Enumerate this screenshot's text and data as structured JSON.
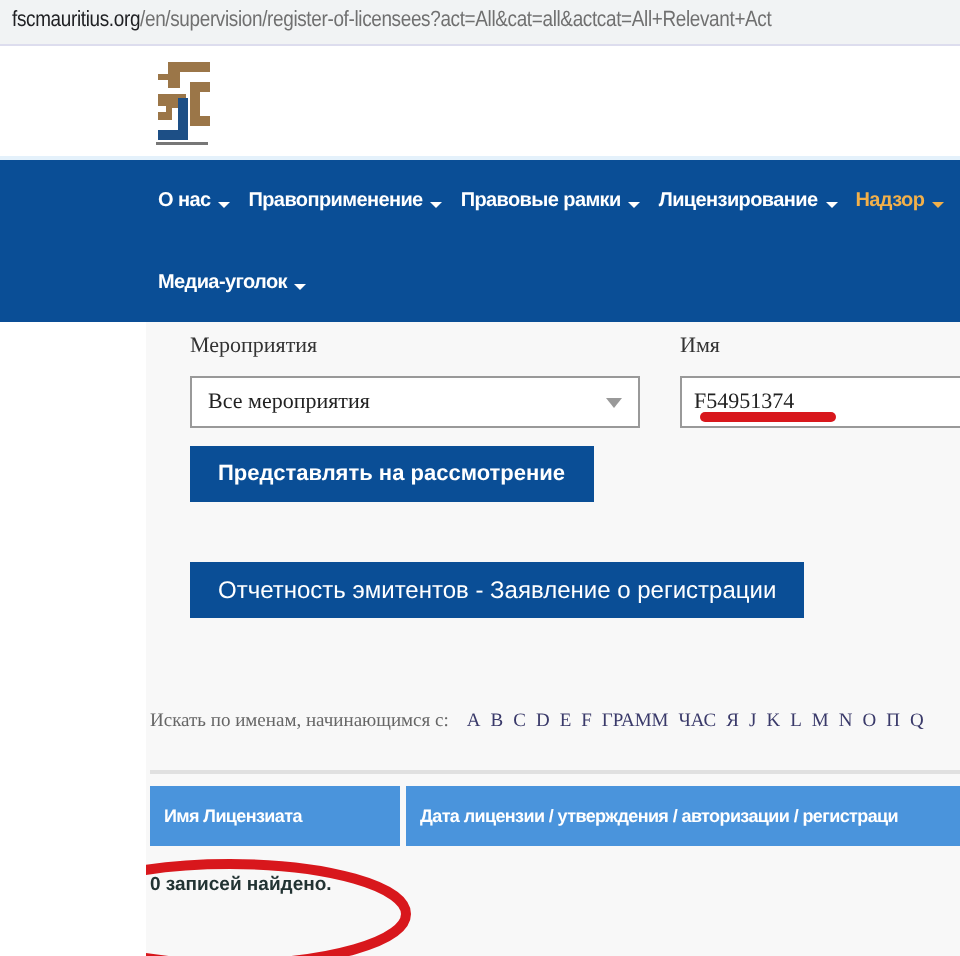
{
  "address_bar": {
    "host": "fscmauritius.org",
    "path": "/en/supervision/register-of-licensees?act=All&cat=all&actcat=All+Relevant+Act"
  },
  "nav": {
    "items": [
      {
        "label": "О нас",
        "selected": false
      },
      {
        "label": "Правоприменение",
        "selected": false
      },
      {
        "label": "Правовые рамки",
        "selected": false
      },
      {
        "label": "Лицензирование",
        "selected": false
      },
      {
        "label": "Надзор",
        "selected": true
      },
      {
        "label": "Медиа-уголок",
        "selected": false
      }
    ]
  },
  "form": {
    "activities_label": "Мероприятия",
    "activities_value": "Все мероприятия",
    "name_label": "Имя",
    "name_value": "F54951374",
    "submit": "Представлять на рассмотрение",
    "issuers_button": "Отчетность эмитентов - Заявление о регистрации"
  },
  "letters": {
    "label": "Искать по именам, начинающимся с:",
    "items": [
      "A",
      "B",
      "C",
      "D",
      "E",
      "F",
      "ГРАММ",
      "ЧАС",
      "Я",
      "J",
      "K",
      "L",
      "M",
      "N",
      "O",
      "П",
      "Q"
    ]
  },
  "table": {
    "columns": [
      "Имя Лицензиата",
      "Дата лицензии / утверждения / авторизации / регистраци"
    ]
  },
  "result": "0 записей найдено.",
  "marked_up": {
    "name_value_underlined": true,
    "result_circled": true
  }
}
